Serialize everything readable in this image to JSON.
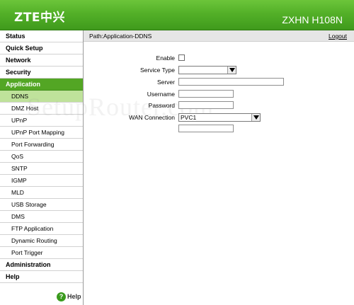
{
  "header": {
    "logo": "ZTE中兴",
    "model": "ZXHN H108N"
  },
  "sidebar": {
    "items": [
      {
        "label": "Status"
      },
      {
        "label": "Quick Setup"
      },
      {
        "label": "Network"
      },
      {
        "label": "Security"
      },
      {
        "label": "Application"
      },
      {
        "label": "DDNS"
      },
      {
        "label": "DMZ Host"
      },
      {
        "label": "UPnP"
      },
      {
        "label": "UPnP Port Mapping"
      },
      {
        "label": "Port Forwarding"
      },
      {
        "label": "QoS"
      },
      {
        "label": "SNTP"
      },
      {
        "label": "IGMP"
      },
      {
        "label": "MLD"
      },
      {
        "label": "USB Storage"
      },
      {
        "label": "DMS"
      },
      {
        "label": "FTP Application"
      },
      {
        "label": "Dynamic Routing"
      },
      {
        "label": "Port Trigger"
      },
      {
        "label": "Administration"
      },
      {
        "label": "Help"
      }
    ],
    "help_label": "Help"
  },
  "pathbar": {
    "path": "Path:Application-DDNS",
    "logout": "Logout"
  },
  "watermark": "SetupRouter.com",
  "form": {
    "enable_label": "Enable",
    "service_type_label": "Service Type",
    "service_type_value": "",
    "server_label": "Server",
    "server_value": "",
    "username_label": "Username",
    "username_value": "",
    "password_label": "Password",
    "password_value": "",
    "wan_label": "WAN Connection",
    "wan_value": "PVC1",
    "extra_value": ""
  },
  "colors": {
    "header_green": "#53b028",
    "active_main": "#53a624",
    "active_sub": "#bfe29b"
  }
}
